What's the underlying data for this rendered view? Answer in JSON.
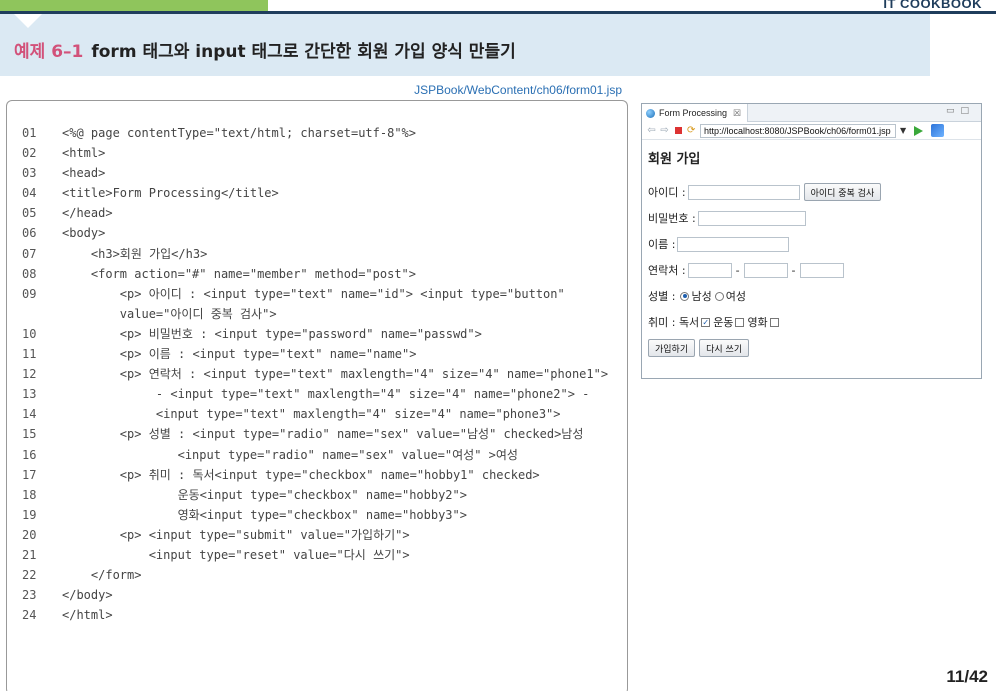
{
  "brand": "IT COOKBOOK",
  "title": {
    "number": "예제 6–1",
    "text": "form 태그와 input 태그로 간단한 회원 가입 양식 만들기"
  },
  "source_path": "JSPBook/WebContent/ch06/form01.jsp",
  "code_lines": [
    {
      "n": "01",
      "t": "<%@ page contentType=\"text/html; charset=utf-8\"%>"
    },
    {
      "n": "02",
      "t": "<html>"
    },
    {
      "n": "03",
      "t": "<head>"
    },
    {
      "n": "04",
      "t": "<title>Form Processing</title>"
    },
    {
      "n": "05",
      "t": "</head>"
    },
    {
      "n": "06",
      "t": "<body>"
    },
    {
      "n": "07",
      "t": "    <h3>회원 가입</h3>"
    },
    {
      "n": "08",
      "t": "    <form action=\"#\" name=\"member\" method=\"post\">"
    },
    {
      "n": "09",
      "t": "        <p> 아이디 : <input type=\"text\" name=\"id\"> <input type=\"button\""
    },
    {
      "n": "",
      "t": "        value=\"아이디 중복 검사\">"
    },
    {
      "n": "10",
      "t": "        <p> 비밀번호 : <input type=\"password\" name=\"passwd\">"
    },
    {
      "n": "11",
      "t": "        <p> 이름 : <input type=\"text\" name=\"name\">"
    },
    {
      "n": "12",
      "t": "        <p> 연락처 : <input type=\"text\" maxlength=\"4\" size=\"4\" name=\"phone1\">"
    },
    {
      "n": "13",
      "t": "             - <input type=\"text\" maxlength=\"4\" size=\"4\" name=\"phone2\"> -"
    },
    {
      "n": "14",
      "t": "             <input type=\"text\" maxlength=\"4\" size=\"4\" name=\"phone3\">"
    },
    {
      "n": "15",
      "t": "        <p> 성별 : <input type=\"radio\" name=\"sex\" value=\"남성\" checked>남성"
    },
    {
      "n": "16",
      "t": "                <input type=\"radio\" name=\"sex\" value=\"여성\" >여성"
    },
    {
      "n": "17",
      "t": "        <p> 취미 : 독서<input type=\"checkbox\" name=\"hobby1\" checked>"
    },
    {
      "n": "18",
      "t": "                운동<input type=\"checkbox\" name=\"hobby2\">"
    },
    {
      "n": "19",
      "t": "                영화<input type=\"checkbox\" name=\"hobby3\">"
    },
    {
      "n": "20",
      "t": "        <p> <input type=\"submit\" value=\"가입하기\">"
    },
    {
      "n": "21",
      "t": "            <input type=\"reset\" value=\"다시 쓰기\">"
    },
    {
      "n": "22",
      "t": "    </form>"
    },
    {
      "n": "23",
      "t": "</body>"
    },
    {
      "n": "24",
      "t": "</html>"
    }
  ],
  "browser": {
    "tab_label": "Form Processing",
    "tab_close": "☒",
    "url": "http://localhost:8080/JSPBook/ch06/form01.jsp",
    "icons": {
      "back": "back-arrow-icon",
      "forward": "forward-arrow-icon",
      "stop": "stop-icon",
      "refresh": "refresh-icon",
      "go": "go-icon"
    }
  },
  "form": {
    "heading": "회원 가입",
    "id_label": "아이디 :",
    "id_check_button": "아이디 중복 검사",
    "passwd_label": "비밀번호 :",
    "name_label": "이름 :",
    "phone_label": "연락처 :",
    "phone_dash": "-",
    "sex_label": "성별 :",
    "sex_male": "남성",
    "sex_female": "여성",
    "hobby_label": "취미 : 독서",
    "hobby_exercise": "운동",
    "hobby_movie": "영화",
    "submit_label": "가입하기",
    "reset_label": "다시 쓰기"
  },
  "page_number": "11/42"
}
